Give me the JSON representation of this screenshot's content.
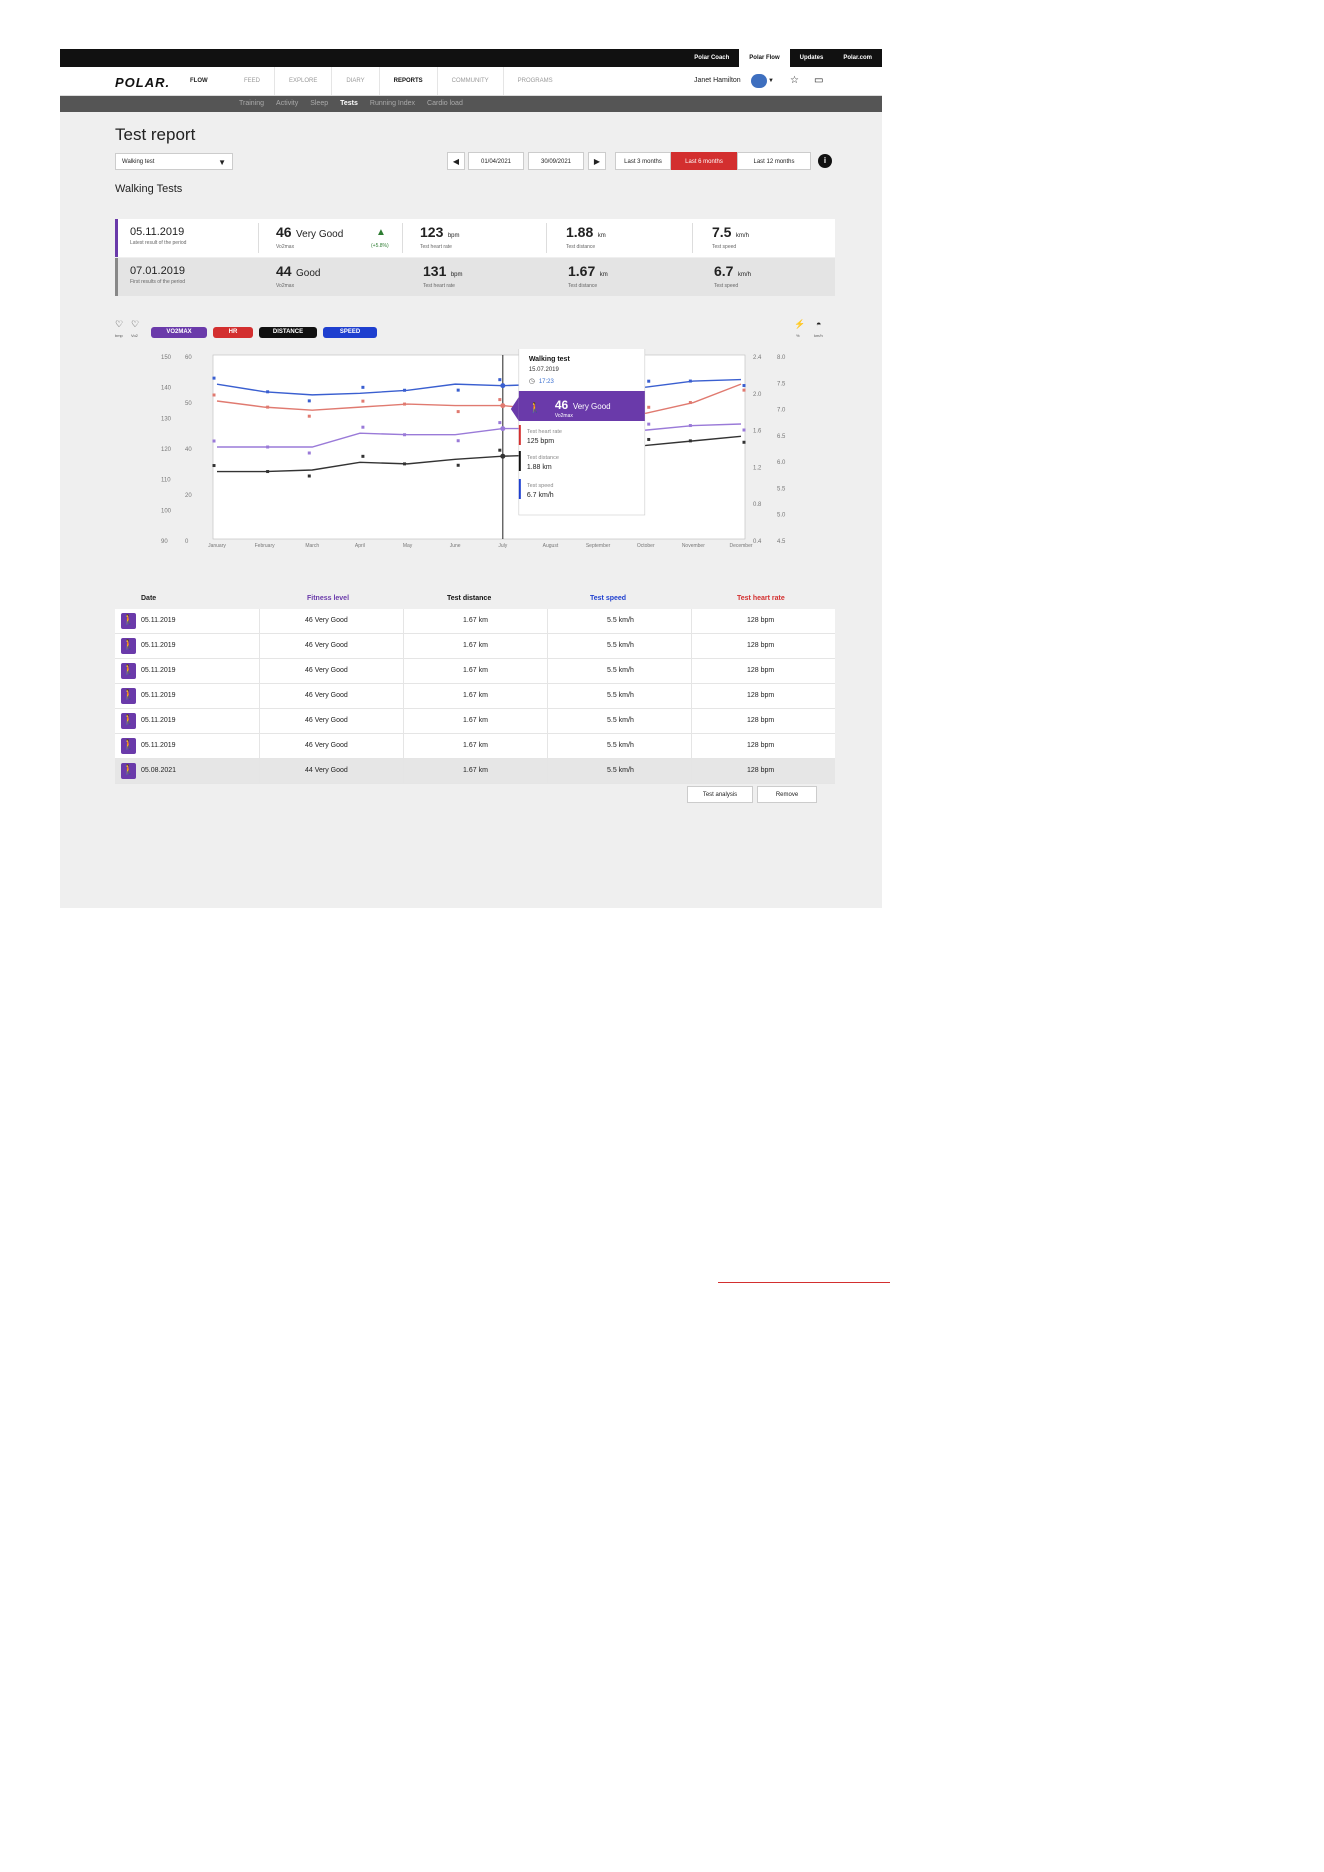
{
  "topbar": {
    "links": [
      "Polar Coach",
      "Polar Flow",
      "Updates",
      "Polar.com"
    ],
    "active_link": "Polar Flow"
  },
  "nav": {
    "logo": "POLAR.",
    "product": "FLOW",
    "items": [
      "FEED",
      "EXPLORE",
      "DIARY",
      "REPORTS",
      "COMMUNITY",
      "PROGRAMS"
    ],
    "active_item": "REPORTS",
    "user_name": "Janet Hamilton",
    "icons": [
      "globe-avatar",
      "star-icon",
      "message-icon"
    ]
  },
  "subnav": {
    "items": [
      "Training",
      "Activity",
      "Sleep",
      "Tests",
      "Running Index",
      "Cardio load"
    ],
    "active_item": "Tests"
  },
  "page": {
    "title": "Test report",
    "test_select": "Walking test",
    "date_from": "01/04/2021",
    "date_to": "30/09/2021",
    "ranges": [
      "Last 3 months",
      "Last 6 months",
      "Last 12 months"
    ],
    "active_range": "Last 6 months",
    "section_title": "Walking Tests"
  },
  "summary": {
    "latest": {
      "date": "05.11.2019",
      "date_label": "Latest result of the period",
      "vo2": "46",
      "rating": "Very Good",
      "vo2_label": "Vo2max",
      "change": "(+5.8%)",
      "hr": "123",
      "hr_unit": "bpm",
      "hr_label": "Test heart rate",
      "dist": "1.88",
      "dist_unit": "km",
      "dist_label": "Test distance",
      "speed": "7.5",
      "speed_unit": "km/h",
      "speed_label": "Test speed"
    },
    "first": {
      "date": "07.01.2019",
      "date_label": "First results of the period",
      "vo2": "44",
      "rating": "Good",
      "vo2_label": "Vo2max",
      "hr": "131",
      "hr_unit": "bpm",
      "hr_label": "Test heart rate",
      "dist": "1.67",
      "dist_unit": "km",
      "dist_label": "Test distance",
      "speed": "6.7",
      "speed_unit": "km/h",
      "speed_label": "Test speed"
    }
  },
  "legend": {
    "left_icons": [
      {
        "label": "bmp"
      },
      {
        "label": "Vo2"
      }
    ],
    "pills": [
      {
        "label": "VO2MAX",
        "color": "#6a3aaa"
      },
      {
        "label": "HR",
        "color": "#d32f2f"
      },
      {
        "label": "DISTANCE",
        "color": "#111111"
      },
      {
        "label": "SPEED",
        "color": "#1e3fcf"
      }
    ],
    "right_icons": [
      {
        "label": "%"
      },
      {
        "label": "km/h"
      }
    ]
  },
  "tooltip": {
    "title": "Walking test",
    "date": "15.07.2019",
    "time": "17:23",
    "vo2": "46",
    "rating": "Very Good",
    "vo2_label": "Vo2max",
    "hr_label": "Test heart rate",
    "hr_value": "125 bpm",
    "dist_label": "Test distance",
    "dist_value": "1.88 km",
    "speed_label": "Test speed",
    "speed_value": "6.7 km/h"
  },
  "chart_data": {
    "type": "line",
    "categories": [
      "January",
      "February",
      "March",
      "April",
      "May",
      "June",
      "July",
      "August",
      "September",
      "October",
      "November",
      "December"
    ],
    "left_axis_outer": [
      "150",
      "140",
      "130",
      "120",
      "110",
      "100",
      "90"
    ],
    "left_axis_inner": [
      "60",
      "50",
      "40",
      "20",
      "0"
    ],
    "right_axis_inner": [
      "2.4",
      "2.0",
      "1.6",
      "1.2",
      "0.8",
      "0.4"
    ],
    "right_axis_outer": [
      "8.0",
      "7.5",
      "7.0",
      "6.5",
      "6.0",
      "5.5",
      "5.0",
      "4.5"
    ],
    "series": [
      {
        "name": "SPEED",
        "color": "#3a5fd0",
        "values": [
          140.5,
          138,
          137,
          137.5,
          138.5,
          140.5,
          140,
          140.5,
          140,
          139.5,
          141.5,
          142
        ]
      },
      {
        "name": "HR",
        "color": "#e07a70",
        "values": [
          135,
          133,
          132,
          133,
          134,
          133.5,
          133.5,
          132,
          131.5,
          131,
          134.5,
          140.5
        ]
      },
      {
        "name": "VO2MAX",
        "color": "#9a7ad8",
        "values": [
          120,
          120,
          120,
          124.5,
          124,
          124,
          126,
          126,
          125.5,
          125.5,
          127,
          127.5
        ]
      },
      {
        "name": "DISTANCE",
        "color": "#333333",
        "values": [
          112,
          112,
          112.5,
          115,
          114.5,
          116,
          117,
          117.5,
          119.5,
          120.5,
          122,
          123.5
        ]
      }
    ],
    "highlight": "July"
  },
  "table": {
    "headers": [
      {
        "label": "Date",
        "color": "#222222"
      },
      {
        "label": "Fitness level",
        "color": "#6a3aaa"
      },
      {
        "label": "Test distance",
        "color": "#111111"
      },
      {
        "label": "Test speed",
        "color": "#1e3fcf"
      },
      {
        "label": "Test heart rate",
        "color": "#d32f2f"
      }
    ],
    "rows": [
      {
        "date": "05.11.2019",
        "fitness": "46 Very Good",
        "distance": "1.67 km",
        "speed": "5.5 km/h",
        "hr": "128 bpm"
      },
      {
        "date": "05.11.2019",
        "fitness": "46 Very Good",
        "distance": "1.67 km",
        "speed": "5.5 km/h",
        "hr": "128 bpm"
      },
      {
        "date": "05.11.2019",
        "fitness": "46 Very Good",
        "distance": "1.67 km",
        "speed": "5.5 km/h",
        "hr": "128 bpm"
      },
      {
        "date": "05.11.2019",
        "fitness": "46 Very Good",
        "distance": "1.67 km",
        "speed": "5.5 km/h",
        "hr": "128 bpm"
      },
      {
        "date": "05.11.2019",
        "fitness": "46 Very Good",
        "distance": "1.67 km",
        "speed": "5.5 km/h",
        "hr": "128 bpm"
      },
      {
        "date": "05.11.2019",
        "fitness": "46 Very Good",
        "distance": "1.67 km",
        "speed": "5.5 km/h",
        "hr": "128 bpm"
      },
      {
        "date": "05.08.2021",
        "fitness": "44 Very Good",
        "distance": "1.67 km",
        "speed": "5.5 km/h",
        "hr": "128 bpm"
      }
    ],
    "actions": [
      "Test analysis",
      "Remove"
    ]
  }
}
